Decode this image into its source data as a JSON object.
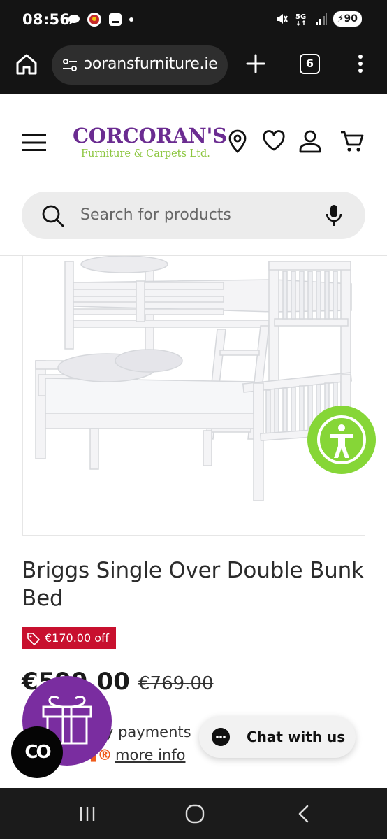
{
  "status_bar": {
    "time": "08:56",
    "network": "5G",
    "battery": "90",
    "notification_icons": [
      "chat-bubble-icon",
      "app-icon",
      "app-square-icon",
      "dot-icon"
    ],
    "system_icons": [
      "mute-icon",
      "network-5g-icon",
      "signal-icon",
      "battery-icon"
    ]
  },
  "browser": {
    "url": "ɔoransfurniture.ie",
    "tab_count": "6",
    "icons": [
      "home-icon",
      "site-settings-icon",
      "plus-icon",
      "tabs-icon",
      "menu-icon"
    ]
  },
  "header": {
    "logo_main": "CORCORAN'S",
    "logo_sub": "Furniture & Carpets Ltd.",
    "brand_purple": "#6b2c91",
    "brand_green": "#8cc63f",
    "icons": [
      "menu-icon",
      "location-pin-icon",
      "heart-icon",
      "account-icon",
      "cart-icon"
    ]
  },
  "search": {
    "placeholder": "Search for products",
    "icons": [
      "search-icon",
      "microphone-icon"
    ]
  },
  "product": {
    "title": "Briggs Single Over Double Bunk Bed",
    "discount_label": "€170.00 off",
    "price_now": "€599.00",
    "price_was": "€769.00",
    "finance_text": "y payments",
    "more_info": "more info",
    "sale_color": "#c8102e"
  },
  "widgets": {
    "chat_label": "Chat with us",
    "co_label": "CO",
    "accessibility_color": "#86d637",
    "gift_color": "#7a2da0"
  },
  "nav_bar": {
    "icons": [
      "recent-apps-icon",
      "home-circle-icon",
      "back-icon"
    ]
  }
}
